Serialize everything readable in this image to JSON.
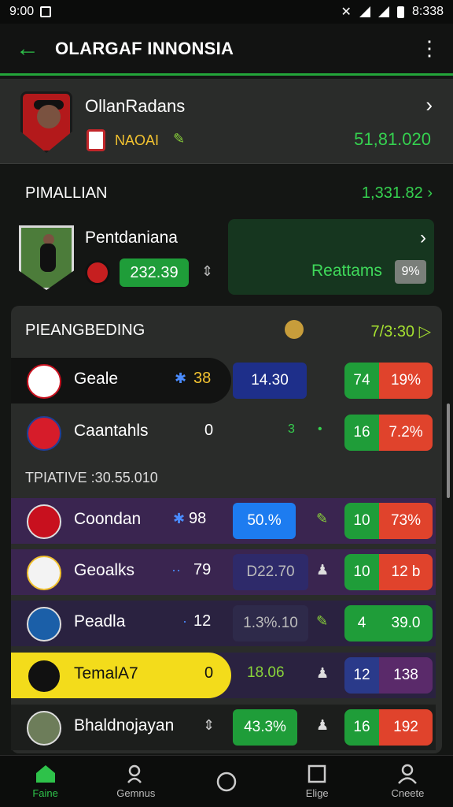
{
  "status_bar": {
    "time": "9:00",
    "right_time": "8:338"
  },
  "app_bar": {
    "title": "OLARGAF INNONSIA"
  },
  "top_card": {
    "name": "OllanRadans",
    "nation": "NAOAI",
    "value": "51,81.020"
  },
  "section1": {
    "title": "PIMALLIAN",
    "value": "1,331.82"
  },
  "player": {
    "name": "Pentdaniana",
    "value": "232.39",
    "promo_label": "Reattams",
    "promo_tag": "9%"
  },
  "table": {
    "title": "PIEANGBEDING",
    "right_value": "7/3:30",
    "rows": [
      {
        "team": "Geale",
        "num": "38",
        "box": "14.30",
        "score_a": "74",
        "score_b": "19%"
      },
      {
        "team": "Caantahls",
        "num": "0",
        "mid": "3",
        "score_a": "16",
        "score_b": "7.2%"
      }
    ],
    "subheader": "TPIATIVE :30.55.010",
    "rows2": [
      {
        "team": "Coondan",
        "num": "98",
        "box": "50.%",
        "score_a": "10",
        "score_b": "73%"
      },
      {
        "team": "Geoalks",
        "num": "79",
        "box": "D22.70",
        "score_a": "10",
        "score_b": "12 b"
      },
      {
        "team": "Peadla",
        "num": "12",
        "box": "1.3%.10",
        "score_a": "4",
        "score_b": "39.0"
      },
      {
        "team": "TemalA7",
        "num": "0",
        "mid": "18.06",
        "score_a": "12",
        "score_b": "138"
      },
      {
        "team": "Bhaldnojayan",
        "box": "43.3%",
        "score_a": "16",
        "score_b": "192"
      }
    ]
  },
  "bottom_nav": [
    {
      "label": "Faine",
      "icon": "home-icon"
    },
    {
      "label": "Gemnus",
      "icon": "person-search-icon"
    },
    {
      "label": "",
      "icon": "circle-icon"
    },
    {
      "label": "Elige",
      "icon": "square-icon"
    },
    {
      "label": "Cneete",
      "icon": "profile-icon"
    }
  ]
}
